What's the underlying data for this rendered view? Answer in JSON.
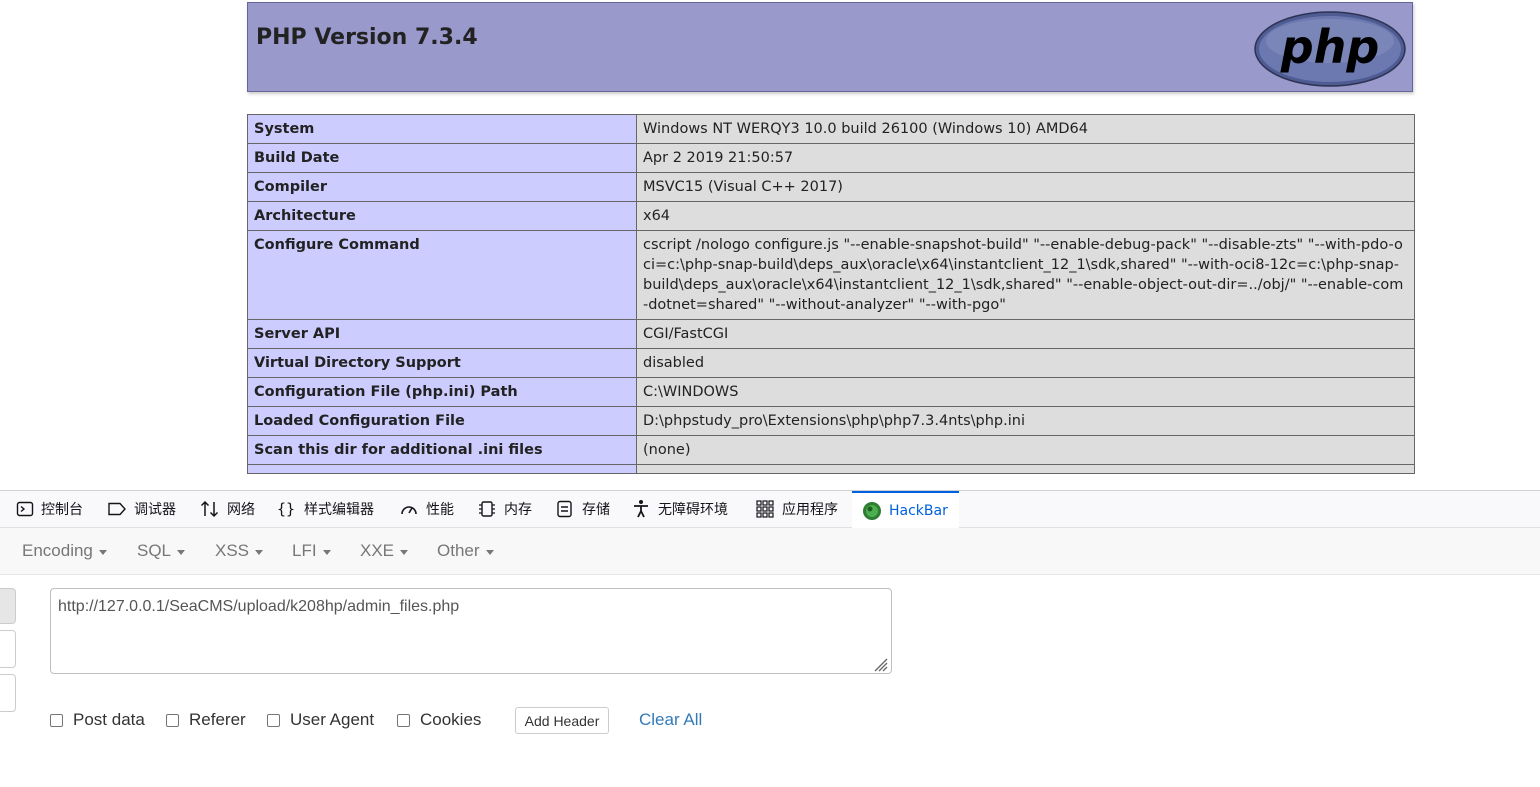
{
  "php": {
    "title": "PHP Version 7.3.4",
    "logo_text": "php",
    "rows": [
      {
        "key": "System",
        "value": "Windows NT WERQY3 10.0 build 26100 (Windows 10) AMD64"
      },
      {
        "key": "Build Date",
        "value": "Apr 2 2019 21:50:57"
      },
      {
        "key": "Compiler",
        "value": "MSVC15 (Visual C++ 2017)"
      },
      {
        "key": "Architecture",
        "value": "x64"
      },
      {
        "key": "Configure Command",
        "value": "cscript /nologo configure.js \"--enable-snapshot-build\" \"--enable-debug-pack\" \"--disable-zts\" \"--with-pdo-oci=c:\\php-snap-build\\deps_aux\\oracle\\x64\\instantclient_12_1\\sdk,shared\" \"--with-oci8-12c=c:\\php-snap-build\\deps_aux\\oracle\\x64\\instantclient_12_1\\sdk,shared\" \"--enable-object-out-dir=../obj/\" \"--enable-com-dotnet=shared\" \"--without-analyzer\" \"--with-pgo\""
      },
      {
        "key": "Server API",
        "value": "CGI/FastCGI"
      },
      {
        "key": "Virtual Directory Support",
        "value": "disabled"
      },
      {
        "key": "Configuration File (php.ini) Path",
        "value": "C:\\WINDOWS"
      },
      {
        "key": "Loaded Configuration File",
        "value": "D:\\phpstudy_pro\\Extensions\\php\\php7.3.4nts\\php.ini"
      },
      {
        "key": "Scan this dir for additional .ini files",
        "value": "(none)"
      },
      {
        "key": "",
        "value": ""
      }
    ]
  },
  "devtools": {
    "tabs": [
      {
        "label": "控制台",
        "icon": "console-icon"
      },
      {
        "label": "调试器",
        "icon": "debugger-icon"
      },
      {
        "label": "网络",
        "icon": "network-icon"
      },
      {
        "label": "样式编辑器",
        "icon": "style-editor-icon"
      },
      {
        "label": "性能",
        "icon": "performance-icon"
      },
      {
        "label": "内存",
        "icon": "memory-icon"
      },
      {
        "label": "存储",
        "icon": "storage-icon"
      },
      {
        "label": "无障碍环境",
        "icon": "accessibility-icon"
      },
      {
        "label": "应用程序",
        "icon": "application-icon"
      },
      {
        "label": "HackBar",
        "icon": "hackbar-icon"
      }
    ],
    "active_tab": "HackBar",
    "accent_color": "#0061e0"
  },
  "hackbar": {
    "menus": [
      "Encoding",
      "SQL",
      "XSS",
      "LFI",
      "XXE",
      "Other"
    ],
    "url": "http://127.0.0.1/SeaCMS/upload/k208hp/admin_files.php",
    "options": [
      "Post data",
      "Referer",
      "User Agent",
      "Cookies"
    ],
    "add_header": "Add Header",
    "clear_all": "Clear All"
  }
}
